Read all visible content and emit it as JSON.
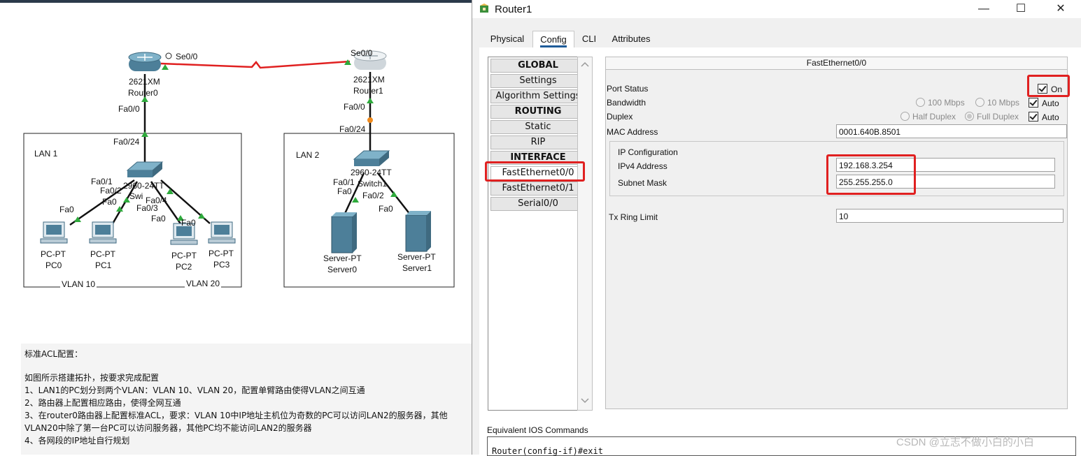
{
  "topology": {
    "labels": {
      "se00_r0": "Se0/0",
      "se00_r1": "Se0/0",
      "r0_model": "2621XM",
      "r0_name": "Router0",
      "r1_model": "2621XM",
      "r1_name": "Router1",
      "r0_fa00": "Fa0/0",
      "r1_fa00": "Fa0/0",
      "sw0_fa024": "Fa0/24",
      "sw1_fa024": "Fa0/24",
      "lan1": "LAN 1",
      "lan2": "LAN 2",
      "sw0_model": "2960-24TT",
      "sw0_name": "Swi",
      "sw1_model": "2960-24TT",
      "sw1_name": "Switch1",
      "sw0_fa01": "Fa0/1",
      "sw0_fa02": "Fa0/2",
      "sw0_fa03": "Fa0/3",
      "sw0_fa04": "Fa0/4",
      "sw1_fa01": "Fa0/1",
      "sw1_fa02": "Fa0/2",
      "pc0_fa0": "Fa0",
      "pc1_fa0": "Fa0",
      "pc2_fa0": "Fa0",
      "pc3_fa0": "Fa0",
      "pc2_fa0b": "Fa0",
      "srv0_fa0": "Fa0",
      "srv1_fa0": "Fa0",
      "pc0_type": "PC-PT",
      "pc0_name": "PC0",
      "pc1_type": "PC-PT",
      "pc1_name": "PC1",
      "pc2_type": "PC-PT",
      "pc2_name": "PC2",
      "pc3_type": "PC-PT",
      "pc3_name": "PC3",
      "srv0_type": "Server-PT",
      "srv0_name": "Server0",
      "srv1_type": "Server-PT",
      "srv1_name": "Server1",
      "vlan10": "VLAN 10",
      "vlan20": "VLAN 20"
    },
    "notes": [
      "标准ACL配置：",
      "如图所示搭建拓扑，按要求完成配置",
      "1、LAN1的PC划分到两个VLAN：VLAN 10、VLAN 20，配置单臂路由使得VLAN之间互通",
      "2、路由器上配置相应路由，使得全网互通",
      "3、在router0路由器上配置标准ACL，要求：VLAN 10中IP地址主机位为奇数的PC可以访问LAN2的服务器，其他",
      "VLAN20中除了第一台PC可以访问服务器，其他PC均不能访问LAN2的服务器",
      "4、各网段的IP地址自行规划"
    ]
  },
  "window": {
    "title": "Router1",
    "controls": {
      "minimize": "—",
      "maximize": "☐",
      "close": "✕"
    },
    "tabs": [
      "Physical",
      "Config",
      "CLI",
      "Attributes"
    ],
    "active_tab": "Config",
    "nav": {
      "global_header": "GLOBAL",
      "settings": "Settings",
      "algorithm_settings": "Algorithm Settings",
      "routing_header": "ROUTING",
      "static": "Static",
      "rip": "RIP",
      "interface_header": "INTERFACE",
      "fa00": "FastEthernet0/0",
      "fa01": "FastEthernet0/1",
      "serial00": "Serial0/0"
    },
    "interface": {
      "title": "FastEthernet0/0",
      "port_status_label": "Port Status",
      "port_status_value": "On",
      "bandwidth_label": "Bandwidth",
      "bw_100": "100 Mbps",
      "bw_10": "10 Mbps",
      "bw_auto": "Auto",
      "duplex_label": "Duplex",
      "half_duplex": "Half Duplex",
      "full_duplex": "Full Duplex",
      "duplex_auto": "Auto",
      "mac_label": "MAC Address",
      "mac_value": "0001.640B.8501",
      "ipconf_label": "IP Configuration",
      "ipv4_label": "IPv4 Address",
      "ipv4_value": "192.168.3.254",
      "mask_label": "Subnet Mask",
      "mask_value": "255.255.255.0",
      "txring_label": "Tx Ring Limit",
      "txring_value": "10"
    },
    "ios_label": "Equivalent IOS Commands",
    "ios_line": "Router(config-if)#exit"
  },
  "watermark": "CSDN @立志不做小白的小白",
  "colors": {
    "highlight_red": "#e02020",
    "link_red": "#e02020",
    "accent_blue": "#1f5c99"
  }
}
